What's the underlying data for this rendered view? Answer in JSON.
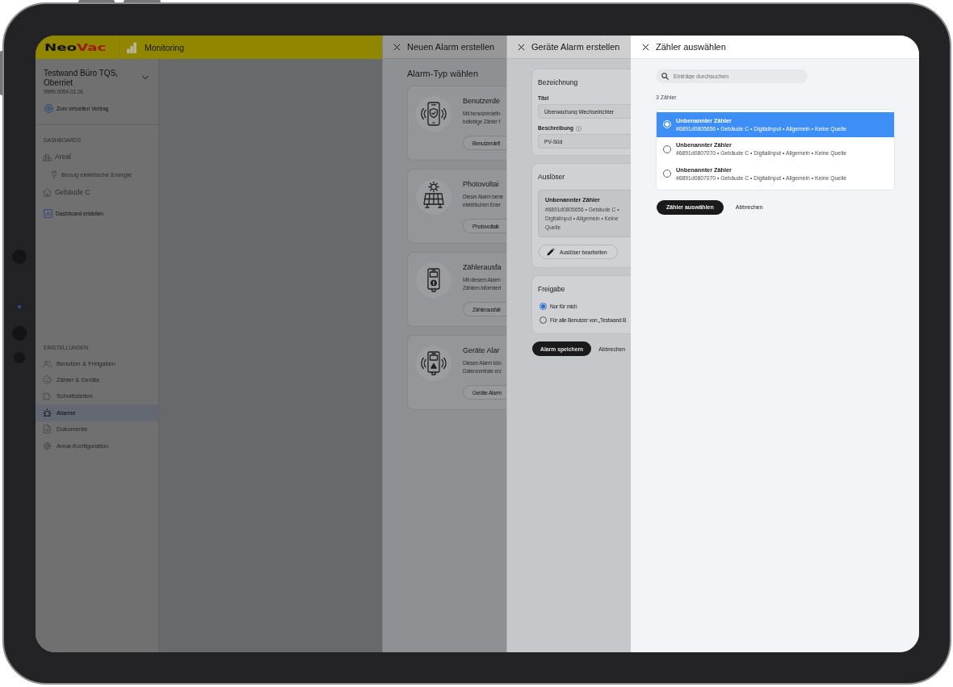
{
  "app_header": {
    "logo": {
      "text": "Neo",
      "accent": "Vac"
    },
    "section": "Monitoring"
  },
  "sidebar": {
    "site": {
      "name": "Testwand Büro TQS, Oberriet",
      "number": "9999.0094.01.01",
      "expanded": false
    },
    "contract_link": "Zum virtuellen Vertrag",
    "sections": [
      {
        "kind": "dashboards",
        "label": "DASHBOARDS",
        "items": [
          {
            "kind": "area",
            "label": "Areal",
            "selected": false,
            "children": [
              {
                "kind": "energy",
                "label": "Bezug elektrische Energie",
                "selected": false
              }
            ]
          },
          {
            "kind": "building",
            "label": "Gebäude C",
            "selected": false
          }
        ],
        "action": "Dashboard erstellen"
      },
      {
        "kind": "settings",
        "label": "EINSTELLUNGEN",
        "items": [
          {
            "kind": "users",
            "label": "Benutzer & Freigaben",
            "selected": false
          },
          {
            "kind": "meters",
            "label": "Zähler & Geräte",
            "selected": false
          },
          {
            "kind": "interfaces",
            "label": "Schnittstellen",
            "selected": false
          },
          {
            "kind": "alarms",
            "label": "Alarme",
            "selected": true
          },
          {
            "kind": "documents",
            "label": "Dokumente",
            "selected": false
          },
          {
            "kind": "configuration",
            "label": "Areal-Konfiguration",
            "selected": false
          }
        ]
      }
    ]
  },
  "panels": [
    {
      "kind": "alarm_types",
      "title": "Neuen Alarm erstellen",
      "heading": "Alarm-Typ wählen",
      "cards": [
        {
          "kind": "custom",
          "title": "Benutzerde",
          "description": [
            "Mit benutzerdefin",
            "beliebige Zähler f"
          ],
          "button": "Benutzerdefi"
        },
        {
          "kind": "photovoltaic",
          "title": "Photovoltai",
          "description": [
            "Dieser Alarm bene",
            "elektrischen Ener"
          ],
          "button": "Photovoltaik"
        },
        {
          "kind": "meter_failure",
          "title": "Zählerausfa",
          "description": [
            "Mit diesem Alarm",
            "Zählern informiert"
          ],
          "button": "Zählerausfall"
        },
        {
          "kind": "device",
          "title": "Geräte Alar",
          "description": [
            "Diesen Alarm kön",
            "Datenzentrale erz"
          ],
          "button": "Geräte Alarm"
        }
      ]
    },
    {
      "kind": "alarm_form",
      "title": "Geräte Alarm erstellen",
      "sections": [
        {
          "kind": "fields",
          "title": "Bezeichnung",
          "fields": [
            {
              "label": "Titel",
              "value": "Überwachung Wechselrichter",
              "info": false
            },
            {
              "label": "Beschreibung",
              "value": "PV-Süd",
              "info": true
            }
          ]
        },
        {
          "kind": "trigger",
          "title": "Auslöser",
          "meter": {
            "name": "Unbenannter Zähler",
            "details": "#6891d0805656 • Gebäude C • DigitalInput • Allgemein • Keine Quelle"
          },
          "button": "Auslöser bearbeiten"
        },
        {
          "kind": "sharing",
          "title": "Freigabe",
          "options": [
            {
              "label": "Nur für mich",
              "selected": true
            },
            {
              "label": "Für alle Benutzer von „Testwand B",
              "selected": false
            }
          ]
        }
      ],
      "buttons": [
        {
          "kind": "primary",
          "label": "Alarm speichern"
        },
        {
          "kind": "secondary",
          "label": "Abbrechen"
        }
      ]
    },
    {
      "kind": "meter_picker",
      "title": "Zähler auswählen",
      "search": {
        "placeholder": "Einträge durchsuchen"
      },
      "count": "3 Zähler",
      "meters": [
        {
          "name": "Unbenannter Zähler",
          "details": "#6891d0805656 • Gebäude C • DigitalInput • Allgemein • Keine Quelle",
          "selected": true
        },
        {
          "name": "Unbenannter Zähler",
          "details": "#6891d0807070 • Gebäude C • DigitalInput • Allgemein • Keine Quelle",
          "selected": false
        },
        {
          "name": "Unbenannter Zähler",
          "details": "#6891d0807070 • Gebäude C • DigitalInput • Allgemein • Keine Quelle",
          "selected": false
        }
      ],
      "buttons": [
        {
          "kind": "primary",
          "label": "Zähler auswählen"
        },
        {
          "kind": "secondary",
          "label": "Abbrechen"
        }
      ]
    }
  ]
}
